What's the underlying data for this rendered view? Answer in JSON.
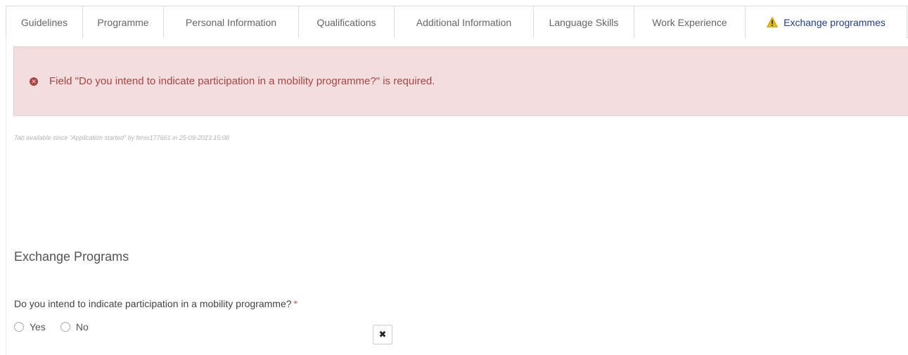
{
  "tabs": [
    {
      "label": "Guidelines"
    },
    {
      "label": "Programme"
    },
    {
      "label": "Personal Information"
    },
    {
      "label": "Qualifications"
    },
    {
      "label": "Additional Information"
    },
    {
      "label": "Language Skills"
    },
    {
      "label": "Work Experience"
    },
    {
      "label": "Exchange programmes",
      "active": true,
      "icon": "warning-icon"
    }
  ],
  "alert": {
    "icon": "error-circle-icon",
    "message": "Field \"Do you intend to indicate participation in a mobility programme?\" is required.",
    "bg_color": "#f2dede",
    "text_color": "#a94442"
  },
  "meta": {
    "text": "Tab available since \"Application started\" by fenix177661 in 25-09-2023 15:08"
  },
  "section": {
    "title": "Exchange Programs"
  },
  "question": {
    "label": "Do you intend to indicate participation in a mobility programme?",
    "required_marker": "*",
    "options": [
      {
        "label": "Yes",
        "selected": false
      },
      {
        "label": "No",
        "selected": false
      }
    ],
    "clear_icon": "close-icon",
    "clear_glyph": "✖"
  },
  "colors": {
    "active_tab_text": "#1f3f8f",
    "warning_icon": "#e6b800",
    "required": "#d9534f"
  }
}
